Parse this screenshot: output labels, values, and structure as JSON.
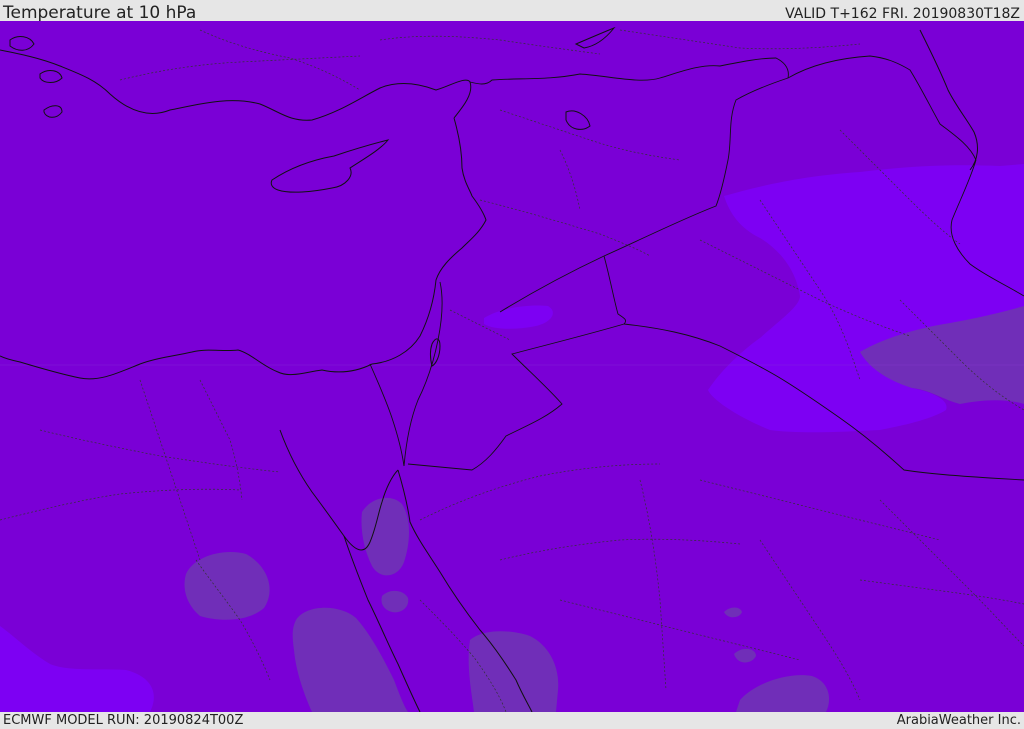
{
  "header": {
    "title": "Temperature at 10 hPa",
    "valid_time": "VALID T+162 FRI. 20190830T18Z"
  },
  "footer": {
    "model_run": "ECMWF MODEL RUN: 20190824T00Z",
    "provider": "ArabiaWeather Inc."
  },
  "map": {
    "colors": {
      "base_field": "#7a00d6",
      "warm_band": "#7d00f3",
      "cool_pocket": "#702eb8",
      "coastline": "#111111",
      "admin_border": "#333333"
    },
    "icons": {
      "coastline": "coastline-path",
      "border": "dashed-border-path"
    }
  }
}
